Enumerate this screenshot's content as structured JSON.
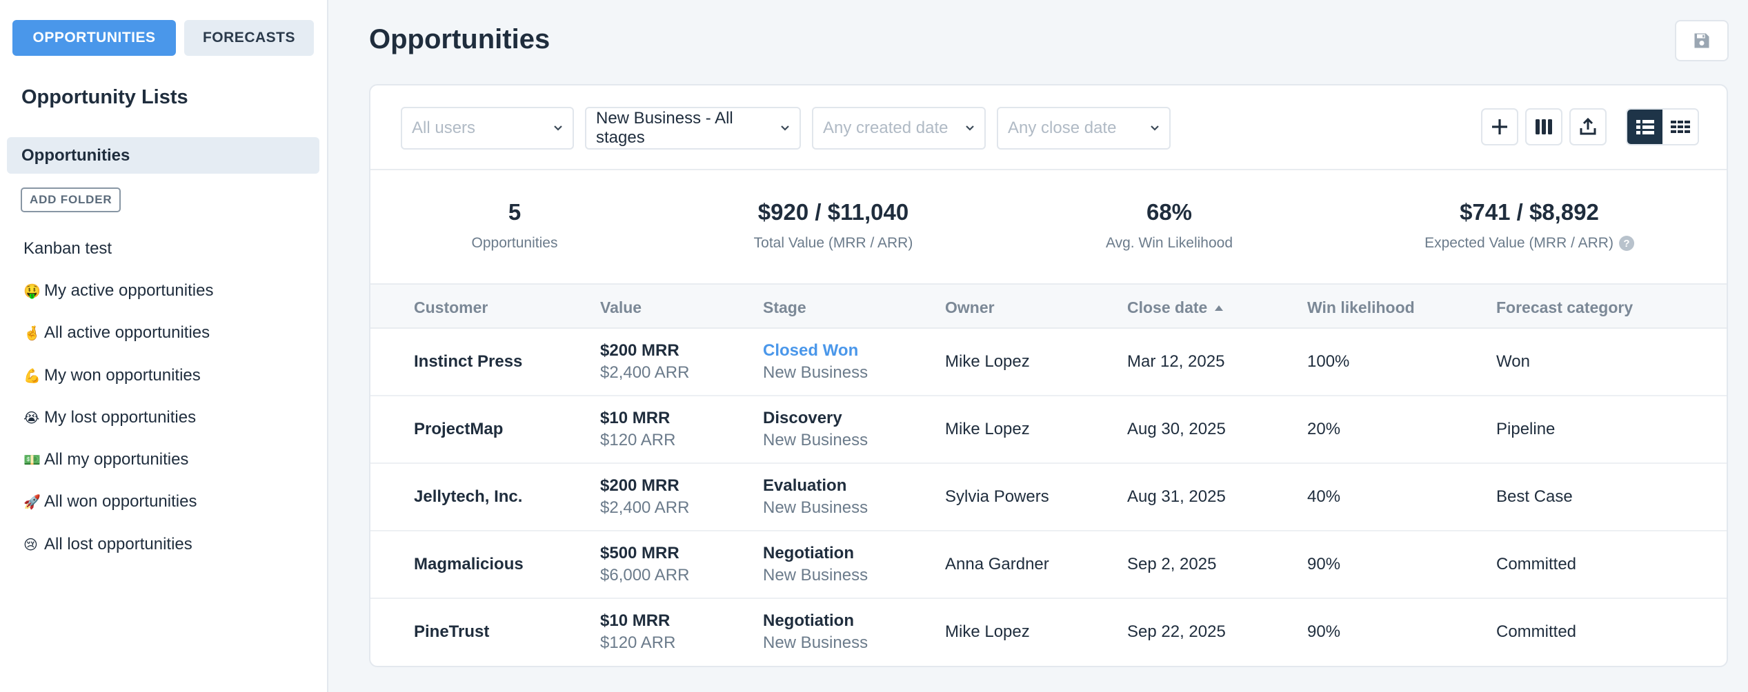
{
  "sidebar": {
    "tabs": [
      {
        "label": "OPPORTUNITIES",
        "active": true
      },
      {
        "label": "FORECASTS",
        "active": false
      }
    ],
    "title": "Opportunity Lists",
    "selected_item": "Opportunities",
    "add_folder_label": "ADD FOLDER",
    "items": [
      {
        "emoji": "",
        "label": "Kanban test"
      },
      {
        "emoji": "🤑",
        "label": "My active opportunities"
      },
      {
        "emoji": "🤞",
        "label": "All active opportunities"
      },
      {
        "emoji": "💪",
        "label": "My won opportunities"
      },
      {
        "emoji": "😭",
        "label": "My lost opportunities"
      },
      {
        "emoji": "💵",
        "label": "All my opportunities"
      },
      {
        "emoji": "🚀",
        "label": "All won opportunities"
      },
      {
        "emoji": "😢",
        "label": "All lost opportunities"
      }
    ]
  },
  "header": {
    "title": "Opportunities",
    "save_icon": "floppy-disk-icon"
  },
  "filters": {
    "users_placeholder": "All users",
    "pipeline_value": "New Business - All stages",
    "created_placeholder": "Any created date",
    "close_placeholder": "Any close date"
  },
  "toolbar": {
    "icons": [
      "plus-icon",
      "columns-icon",
      "export-icon",
      "list-view-icon",
      "grid-view-icon"
    ],
    "active_view": "list"
  },
  "stats": [
    {
      "value": "5",
      "label": "Opportunities"
    },
    {
      "value": "$920 / $11,040",
      "label": "Total Value (MRR / ARR)"
    },
    {
      "value": "68%",
      "label": "Avg. Win Likelihood"
    },
    {
      "value": "$741 / $8,892",
      "label": "Expected Value (MRR / ARR)",
      "help": "?"
    }
  ],
  "table": {
    "columns": [
      "Customer",
      "Value",
      "Stage",
      "Owner",
      "Close date",
      "Win likelihood",
      "Forecast category"
    ],
    "sort_column": "Close date",
    "sort_direction": "asc",
    "rows": [
      {
        "customer": "Instinct Press",
        "mrr": "$200 MRR",
        "arr": "$2,400 ARR",
        "stage": "Closed Won",
        "pipeline": "New Business",
        "owner": "Mike Lopez",
        "close_date": "Mar 12, 2025",
        "win": "100%",
        "forecast": "Won"
      },
      {
        "customer": "ProjectMap",
        "mrr": "$10 MRR",
        "arr": "$120 ARR",
        "stage": "Discovery",
        "pipeline": "New Business",
        "owner": "Mike Lopez",
        "close_date": "Aug 30, 2025",
        "win": "20%",
        "forecast": "Pipeline"
      },
      {
        "customer": "Jellytech, Inc.",
        "mrr": "$200 MRR",
        "arr": "$2,400 ARR",
        "stage": "Evaluation",
        "pipeline": "New Business",
        "owner": "Sylvia Powers",
        "close_date": "Aug 31, 2025",
        "win": "40%",
        "forecast": "Best Case"
      },
      {
        "customer": "Magmalicious",
        "mrr": "$500 MRR",
        "arr": "$6,000 ARR",
        "stage": "Negotiation",
        "pipeline": "New Business",
        "owner": "Anna Gardner",
        "close_date": "Sep 2, 2025",
        "win": "90%",
        "forecast": "Committed"
      },
      {
        "customer": "PineTrust",
        "mrr": "$10 MRR",
        "arr": "$120 ARR",
        "stage": "Negotiation",
        "pipeline": "New Business",
        "owner": "Mike Lopez",
        "close_date": "Sep 22, 2025",
        "win": "90%",
        "forecast": "Committed"
      }
    ]
  },
  "colors": {
    "accent": "#4a97ea",
    "dark": "#1e3448",
    "text": "#1f2d3d",
    "muted": "#6b7b8b"
  }
}
